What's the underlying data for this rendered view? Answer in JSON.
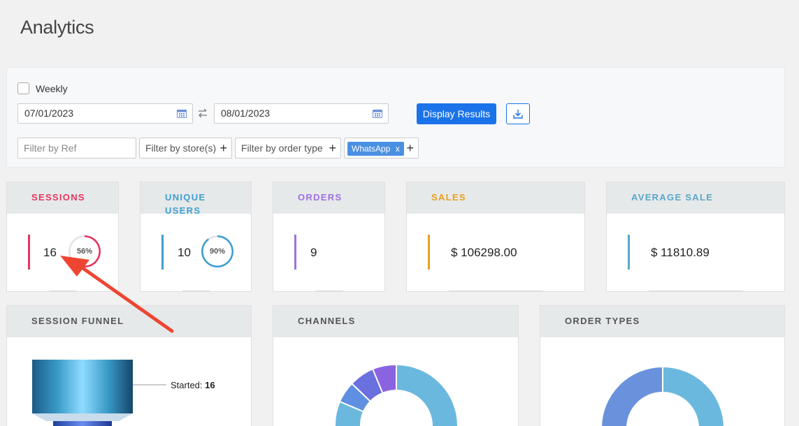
{
  "page": {
    "title": "Analytics"
  },
  "filters": {
    "weekly_label": "Weekly",
    "start_date": "07/01/2023",
    "end_date": "08/01/2023",
    "display_button": "Display Results",
    "ref_placeholder": "Filter by Ref",
    "store_label": "Filter by store(s)",
    "order_type_label": "Filter by order type",
    "channel_chip": "WhatsApp",
    "chip_close": "x",
    "plus": "+"
  },
  "stats": {
    "sessions": {
      "title": "SESSIONS",
      "value": "16",
      "percent": "56%",
      "ratio": 0.56,
      "color": "#e8365d"
    },
    "unique_users": {
      "title": "UNIQUE USERS",
      "value": "10",
      "percent": "90%",
      "ratio": 0.9,
      "color": "#3f9fcf"
    },
    "orders": {
      "title": "ORDERS",
      "value": "9",
      "color": "#a070e0"
    },
    "sales": {
      "title": "SALES",
      "value": "$ 106298.00",
      "color": "#e8a020"
    },
    "average_sale": {
      "title": "AVERAGE SALE",
      "value": "$ 11810.89",
      "color": "#5aa6c8"
    }
  },
  "panels": {
    "session_funnel": {
      "title": "SESSION FUNNEL",
      "started_label": "Started:",
      "started_value": "16"
    },
    "channels": {
      "title": "CHANNELS"
    },
    "order_types": {
      "title": "ORDER TYPES"
    }
  }
}
